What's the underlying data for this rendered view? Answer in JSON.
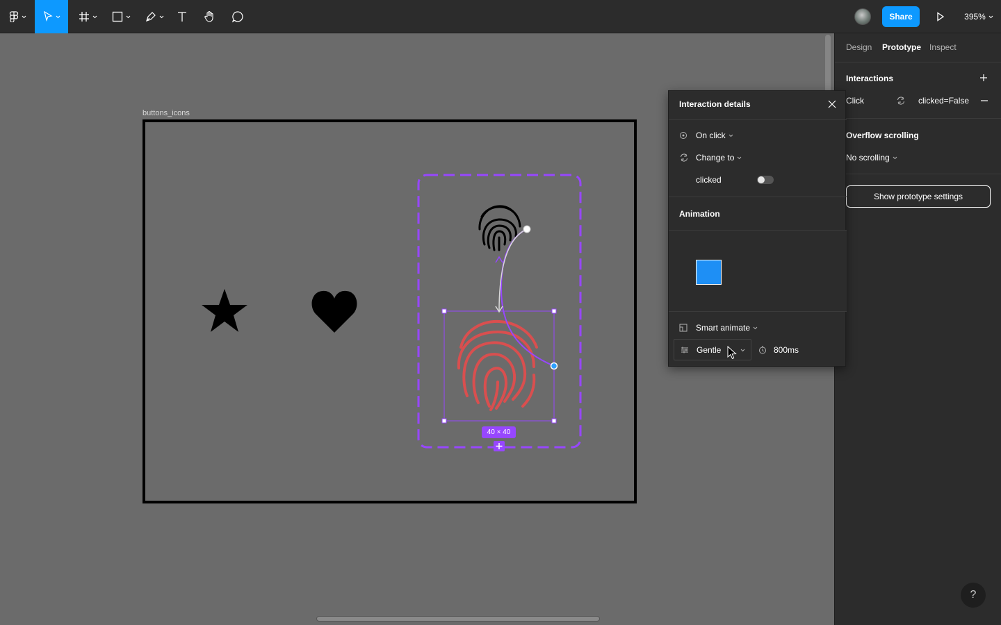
{
  "toolbar": {
    "zoom": "395%",
    "share_label": "Share"
  },
  "canvas": {
    "frame_label": "buttons_icons",
    "size_badge": "40 × 40"
  },
  "right_panel": {
    "tabs": [
      "Design",
      "Prototype",
      "Inspect"
    ],
    "active_tab": "Prototype",
    "interactions_heading": "Interactions",
    "interaction": {
      "trigger": "Click",
      "value": "clicked=False"
    },
    "overflow_heading": "Overflow scrolling",
    "overflow_value": "No scrolling",
    "prototype_button": "Show prototype settings",
    "help": "?"
  },
  "popup": {
    "title": "Interaction details",
    "trigger": "On click",
    "action": "Change to",
    "property": "clicked",
    "property_value": false,
    "animation_heading": "Animation",
    "animation_type": "Smart animate",
    "easing": "Gentle",
    "duration": "800ms"
  },
  "colors": {
    "accent": "#0d99ff",
    "component_outline": "#9747ff",
    "fingerprint_active": "#d94f4f",
    "preview_box": "#1e8ff5"
  }
}
